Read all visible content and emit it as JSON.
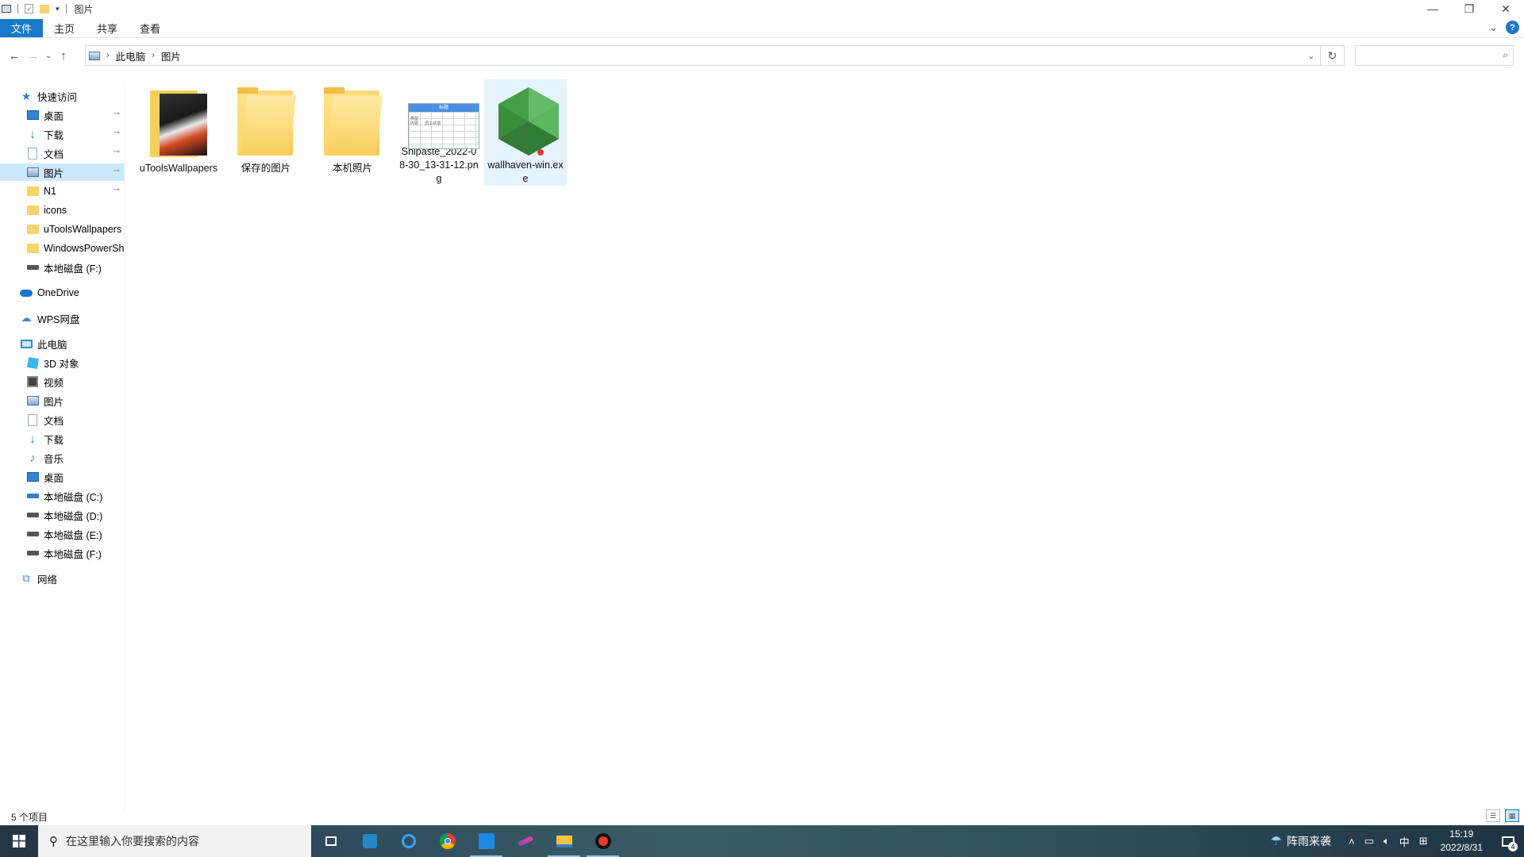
{
  "window": {
    "title": "图片",
    "caption": {
      "minimize": "—",
      "restore": "❐",
      "close": "✕"
    }
  },
  "ribbon": {
    "tabs": [
      "文件",
      "主页",
      "共享",
      "查看"
    ],
    "expand_glyph": "⌄",
    "help_glyph": "?"
  },
  "nav": {
    "back": "←",
    "forward": "→",
    "recent": "⌄",
    "up": "↑"
  },
  "address": {
    "crumbs": [
      "此电脑",
      "图片"
    ],
    "dropdown_glyph": "⌄",
    "refresh_glyph": "↻",
    "search_placeholder": ""
  },
  "sidebar": {
    "quick_access": "快速访问",
    "quick_items": [
      {
        "label": "桌面",
        "icon": "desktop-icon",
        "pinned": true
      },
      {
        "label": "下载",
        "icon": "download-icon",
        "pinned": true
      },
      {
        "label": "文档",
        "icon": "document-icon",
        "pinned": true
      },
      {
        "label": "图片",
        "icon": "pictures-icon",
        "pinned": true,
        "selected": true
      },
      {
        "label": "N1",
        "icon": "folder-icon",
        "pinned": true
      },
      {
        "label": "icons",
        "icon": "folder-icon"
      },
      {
        "label": "uToolsWallpapers",
        "icon": "folder-icon"
      },
      {
        "label": "WindowsPowerSh",
        "icon": "folder-icon"
      },
      {
        "label": "本地磁盘 (F:)",
        "icon": "drive-icon"
      }
    ],
    "onedrive": "OneDrive",
    "wps": "WPS网盘",
    "this_pc": "此电脑",
    "pc_items": [
      {
        "label": "3D 对象",
        "icon": "3d-objects-icon"
      },
      {
        "label": "视频",
        "icon": "videos-icon"
      },
      {
        "label": "图片",
        "icon": "pictures-icon"
      },
      {
        "label": "文档",
        "icon": "document-icon"
      },
      {
        "label": "下载",
        "icon": "download-icon"
      },
      {
        "label": "音乐",
        "icon": "music-icon"
      },
      {
        "label": "桌面",
        "icon": "desktop-icon"
      },
      {
        "label": "本地磁盘 (C:)",
        "icon": "drive-icon"
      },
      {
        "label": "本地磁盘 (D:)",
        "icon": "drive-icon"
      },
      {
        "label": "本地磁盘 (E:)",
        "icon": "drive-icon"
      },
      {
        "label": "本地磁盘 (F:)",
        "icon": "drive-icon"
      }
    ],
    "network": "网络",
    "pin_glyph": "📌"
  },
  "files": [
    {
      "name": "uToolsWallpapers",
      "type": "wallpaper-folder"
    },
    {
      "name": "保存的图片",
      "type": "folder"
    },
    {
      "name": "本机照片",
      "type": "folder"
    },
    {
      "name": "Snipaste_2022-08-30_13-31-12.png",
      "type": "image",
      "thumb_header": "标题",
      "thumb_text": "类型\n内容      员工共享"
    },
    {
      "name": "wallhaven-win.exe",
      "type": "exe",
      "selected": true
    }
  ],
  "statusbar": {
    "count": "5 个项目"
  },
  "taskbar": {
    "search_placeholder": "在这里输入你要搜索的内容",
    "weather": "阵雨来袭",
    "ime": "中",
    "time": "15:19",
    "date": "2022/8/31",
    "notifications": "4"
  },
  "colors": {
    "accent": "#1979ca",
    "selection": "#cce8ff",
    "folder": "#f6d36b"
  }
}
